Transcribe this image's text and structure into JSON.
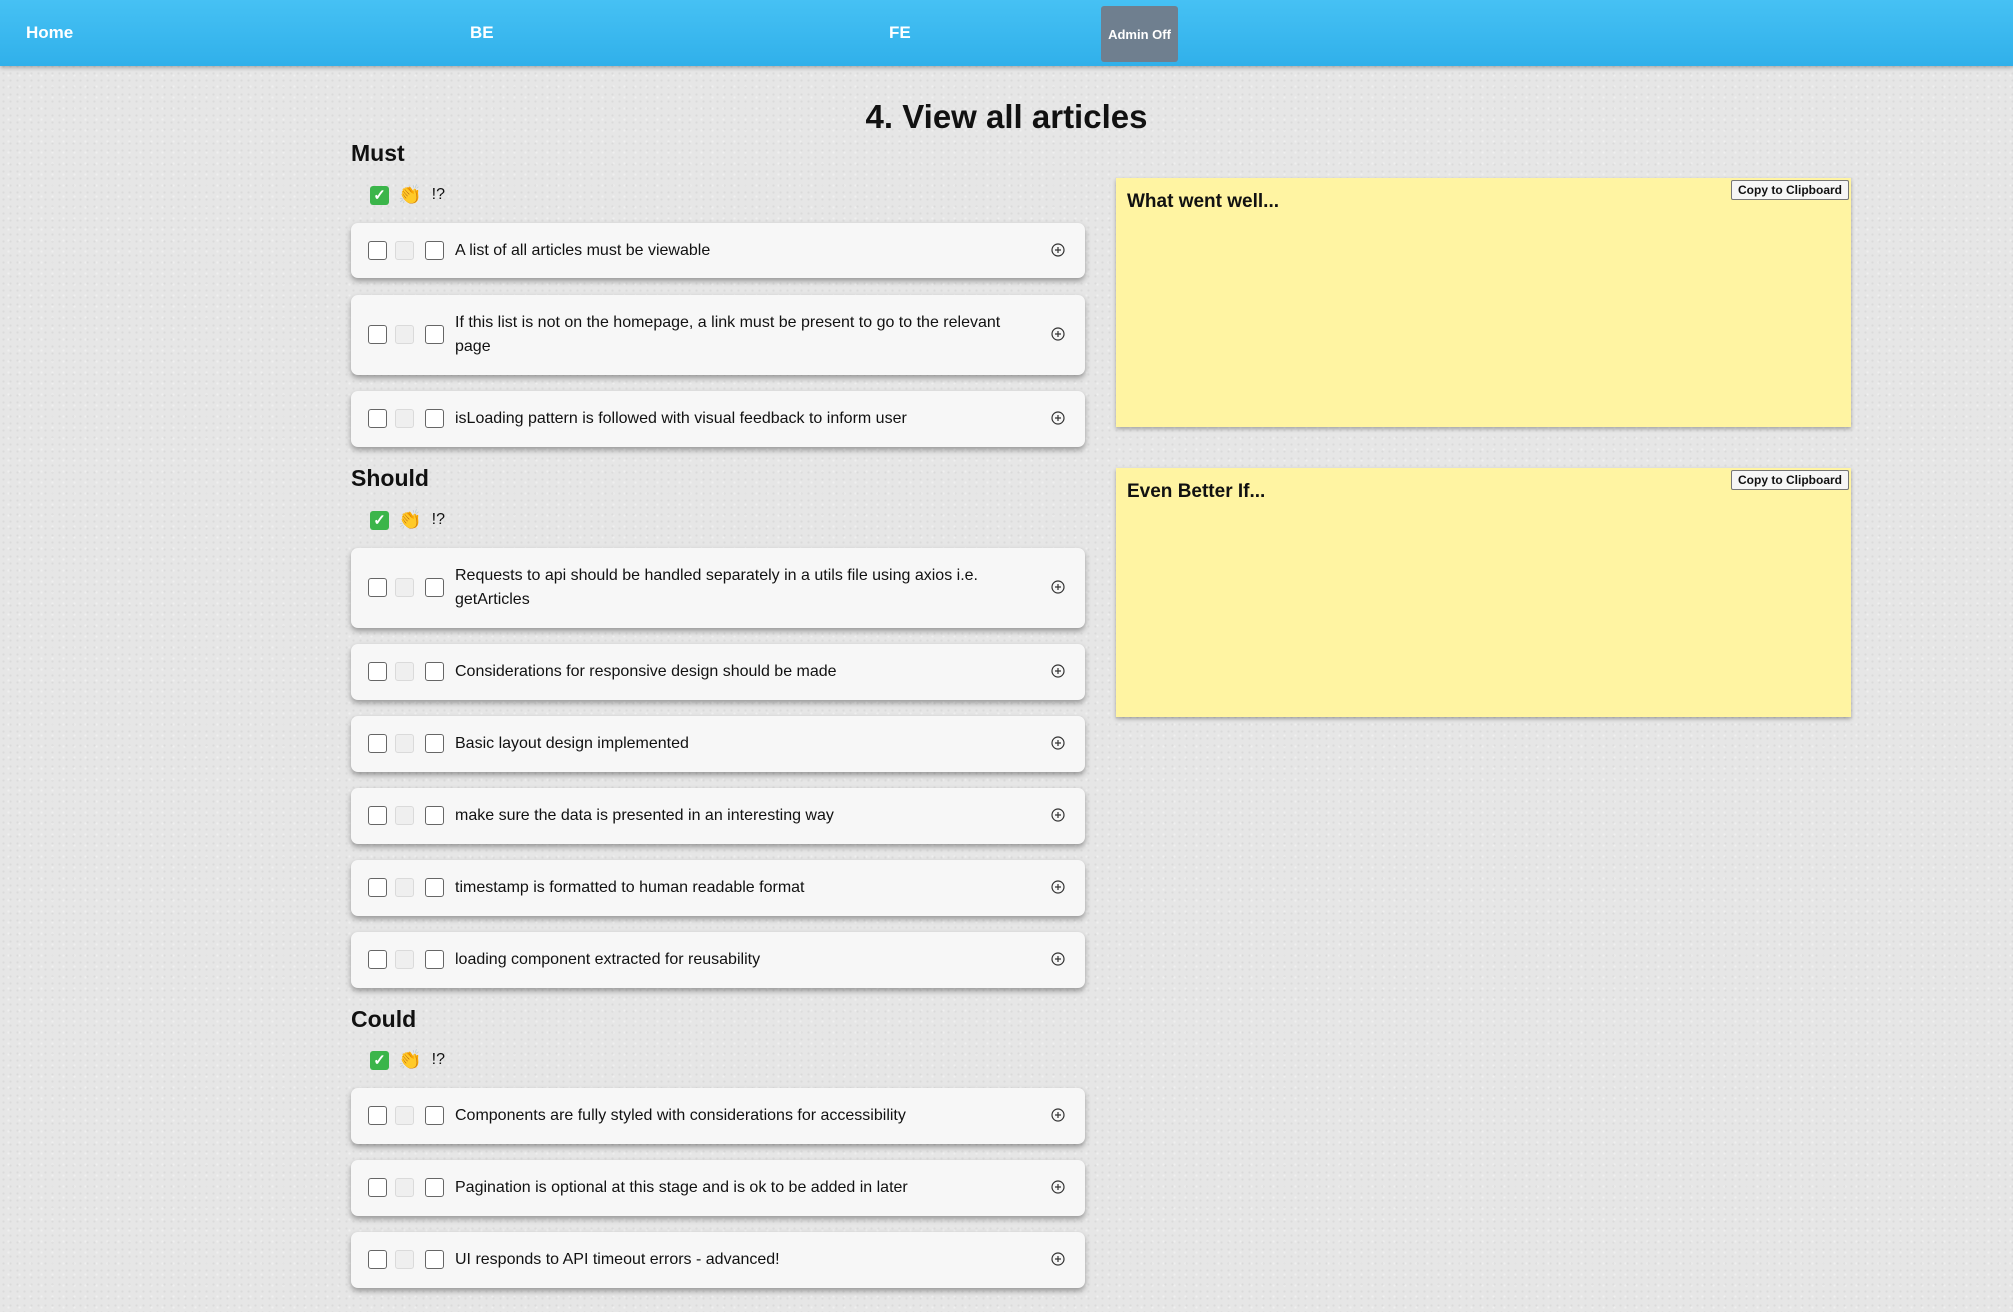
{
  "nav": {
    "home": "Home",
    "be": "BE",
    "fe": "FE",
    "admin": "Admin Off"
  },
  "page_title": "4. View all articles",
  "legend": {
    "clap_icon": "clapping-hands-icon",
    "question": "!?"
  },
  "sections": {
    "must": {
      "heading": "Must",
      "items": [
        "A list of all articles must be viewable",
        "If this list is not on the homepage, a link must be present to go to the relevant page",
        "isLoading pattern is followed with visual feedback to inform user"
      ]
    },
    "should": {
      "heading": "Should",
      "items": [
        "Requests to api should be handled separately in a utils file using axios i.e. getArticles",
        "Considerations for responsive design should be made",
        "Basic layout design implemented",
        "make sure the data is presented in an interesting way",
        "timestamp is formatted to human readable format",
        "loading component extracted for reusability"
      ]
    },
    "could": {
      "heading": "Could",
      "items": [
        "Components are fully styled with considerations for accessibility",
        "Pagination is optional at this stage and is ok to be added in later",
        "UI responds to API timeout errors - advanced!"
      ]
    }
  },
  "notes": {
    "went_well": {
      "title": "What went well...",
      "copy_label": "Copy to Clipboard"
    },
    "even_better": {
      "title": "Even Better If...",
      "copy_label": "Copy to Clipboard"
    }
  },
  "colors": {
    "navbar": "#3bb8ef",
    "admin_button": "#6f7f8f",
    "sticky_note": "#fff4a2",
    "check": "#3bb54a"
  }
}
